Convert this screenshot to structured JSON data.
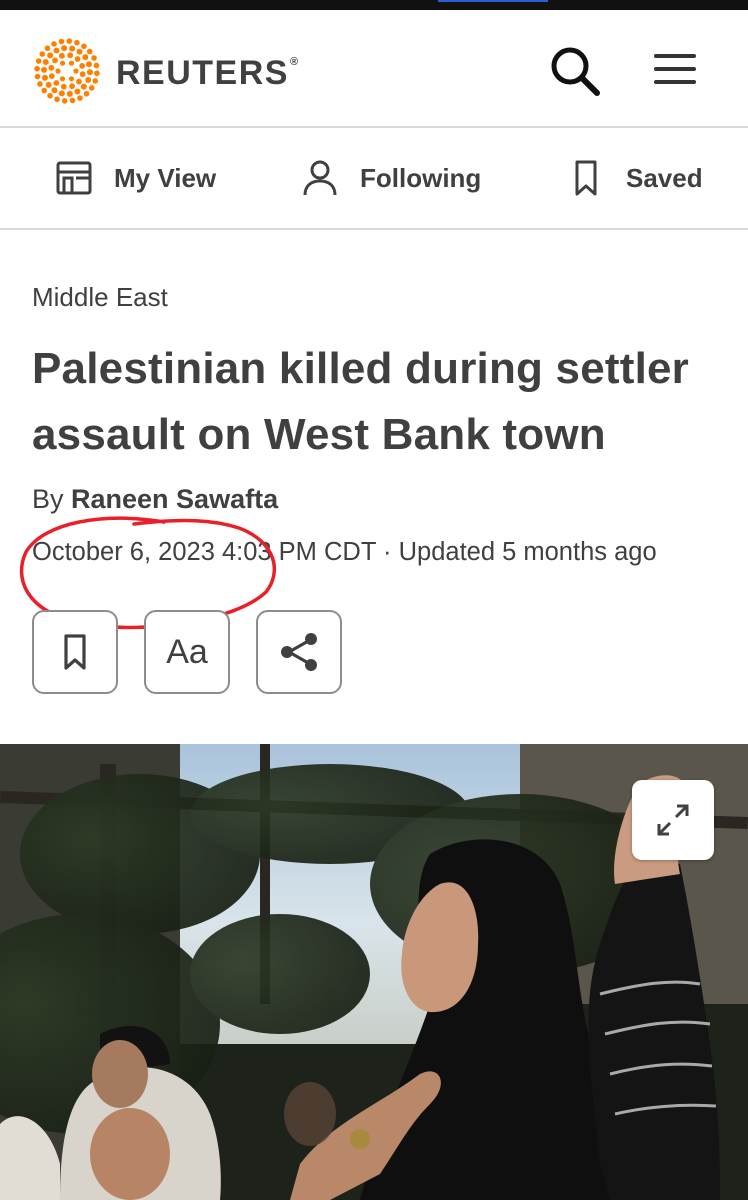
{
  "header": {
    "brand": "REUTERS",
    "registered_mark": "®",
    "search_icon": "search-icon",
    "menu_icon": "hamburger-menu-icon"
  },
  "subnav": {
    "items": [
      {
        "label": "My View",
        "icon": "layout-icon"
      },
      {
        "label": "Following",
        "icon": "person-icon"
      },
      {
        "label": "Saved",
        "icon": "bookmark-icon"
      }
    ]
  },
  "article": {
    "category": "Middle East",
    "headline": "Palestinian killed during settler assault on West Bank town",
    "byline_prefix": "By ",
    "author": "Raneen Sawafta",
    "dateline": "October 6, 2023 4:03 PM CDT · Updated 5 months ago",
    "actions": {
      "bookmark_icon": "bookmark-icon",
      "text_size_label": "Aa",
      "share_icon": "share-icon"
    },
    "photo": {
      "expand_icon": "expand-icon"
    }
  },
  "colors": {
    "brand_orange": "#ff8000",
    "text": "#404040",
    "annotation_red": "#e8202a",
    "progress_blue": "#2b5fd0"
  }
}
